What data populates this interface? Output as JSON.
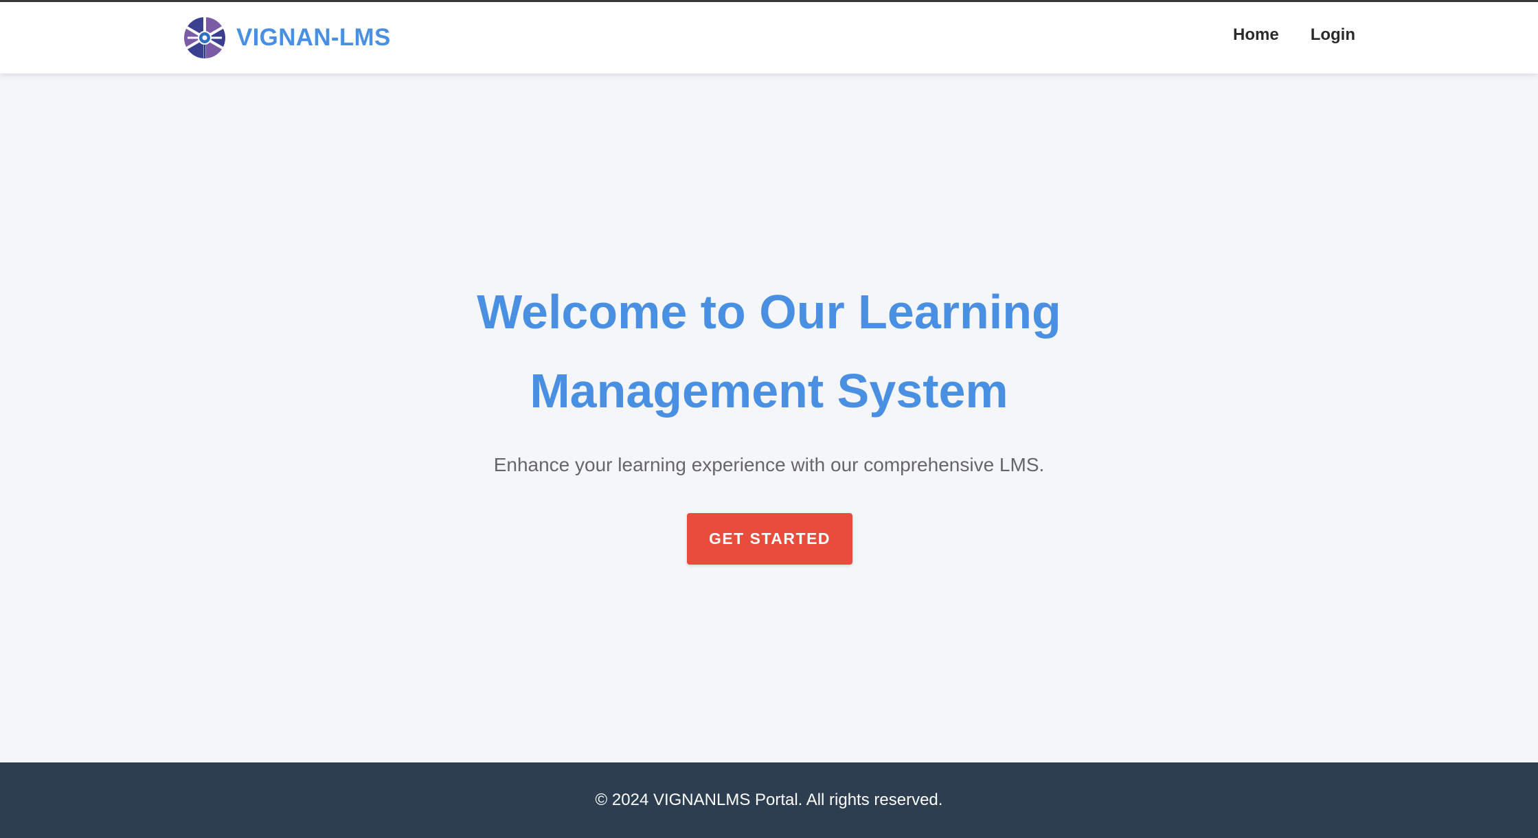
{
  "brand": {
    "name": "VIGNAN-LMS",
    "logo_icon": "vignan-wheel-logo-icon",
    "color": "#4a90e2"
  },
  "nav": {
    "items": [
      {
        "label": "Home"
      },
      {
        "label": "Login"
      }
    ]
  },
  "hero": {
    "title_line1": "Welcome to Our Learning",
    "title_line2": "Management System",
    "subtitle": "Enhance your learning experience with our comprehensive LMS.",
    "cta_label": "GET STARTED",
    "title_color": "#4a90e2",
    "cta_color": "#e74c3c",
    "background": "#f4f6f9"
  },
  "footer": {
    "text": "© 2024 VIGNANLMS Portal. All rights reserved.",
    "background": "#2c3e50"
  }
}
